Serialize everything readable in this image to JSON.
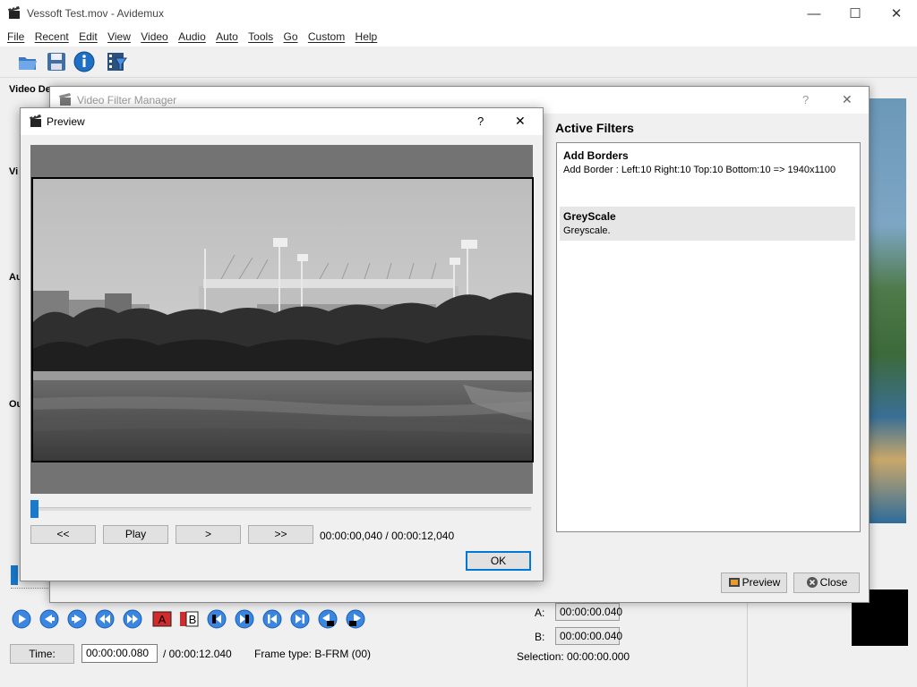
{
  "window": {
    "title": "Vessoft Test.mov - Avidemux"
  },
  "menu": [
    "File",
    "Recent",
    "Edit",
    "View",
    "Video",
    "Audio",
    "Auto",
    "Tools",
    "Go",
    "Custom",
    "Help"
  ],
  "main": {
    "side_labels": [
      "Video De",
      "Vi",
      "Au",
      "Ou"
    ],
    "time_label": "Time:",
    "time_value": "00:00:00.080",
    "total_time": "/ 00:00:12.040",
    "frame_type": "Frame type:  B-FRM (00)",
    "a_label": "A:",
    "a_value": "00:00:00.040",
    "b_label": "B:",
    "b_value": "00:00:00.040",
    "selection": "Selection: 00:00:00.000"
  },
  "vfm": {
    "title": "Video Filter Manager",
    "help": "?",
    "close": "✕",
    "active_filters_title": "Active Filters",
    "filters": [
      {
        "name": "Add Borders",
        "desc": "Add Border : Left:10 Right:10 Top:10 Bottom:10 => 1940x1100"
      },
      {
        "name": "GreyScale",
        "desc": "Greyscale."
      }
    ],
    "preview_button": "Preview",
    "close_button": "Close"
  },
  "preview": {
    "title": "Preview",
    "help": "?",
    "close": "✕",
    "btn_rewind": "<<",
    "btn_play": "Play",
    "btn_next": ">",
    "btn_forward": ">>",
    "time": "00:00:00,040 / 00:00:12,040",
    "ok": "OK",
    "slider_position": 0.0
  },
  "colors": {
    "accent": "#1979ca",
    "preview_bg": "#737373"
  }
}
